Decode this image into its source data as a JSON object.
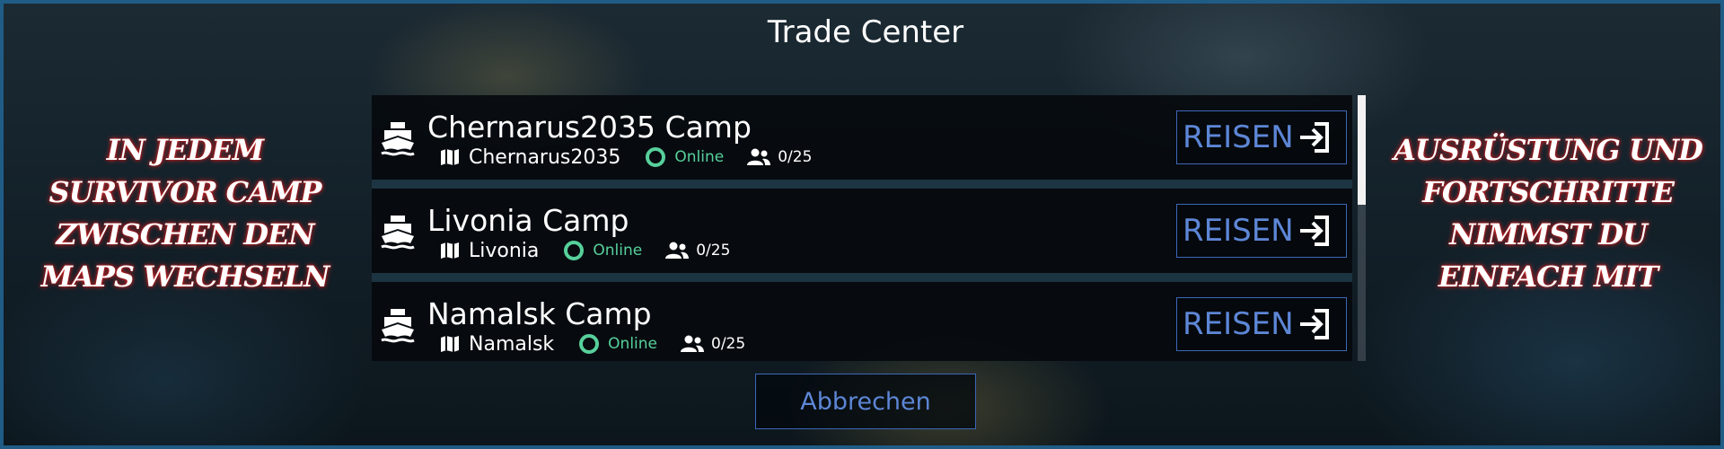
{
  "window": {
    "title": "Trade Center"
  },
  "left_caption": {
    "lines": [
      "In jedem",
      "Survivor Camp",
      "zwischen den",
      "Maps wechseln"
    ]
  },
  "right_caption": {
    "lines": [
      "Ausrüstung und",
      "Fortschritte",
      "nimmst du",
      "einfach mit"
    ]
  },
  "camps": [
    {
      "name": "Chernarus2035 Camp",
      "map": "Chernarus2035",
      "status": "Online",
      "players": "0/25",
      "travel_label": "REISEN"
    },
    {
      "name": "Livonia Camp",
      "map": "Livonia",
      "status": "Online",
      "players": "0/25",
      "travel_label": "REISEN"
    },
    {
      "name": "Namalsk Camp",
      "map": "Namalsk",
      "status": "Online",
      "players": "0/25",
      "travel_label": "REISEN"
    }
  ],
  "footer": {
    "cancel_label": "Abbrechen"
  },
  "icons": {
    "camp": "ship-icon",
    "map": "map-icon",
    "status": "online-status-icon",
    "players": "users-icon",
    "travel": "enter-icon"
  },
  "colors": {
    "accent": "#5d86d6",
    "accent_border": "#3d67b8",
    "online": "#57d09b",
    "frame_border": "#1f5c86",
    "caption_glow": "#ff2828"
  }
}
